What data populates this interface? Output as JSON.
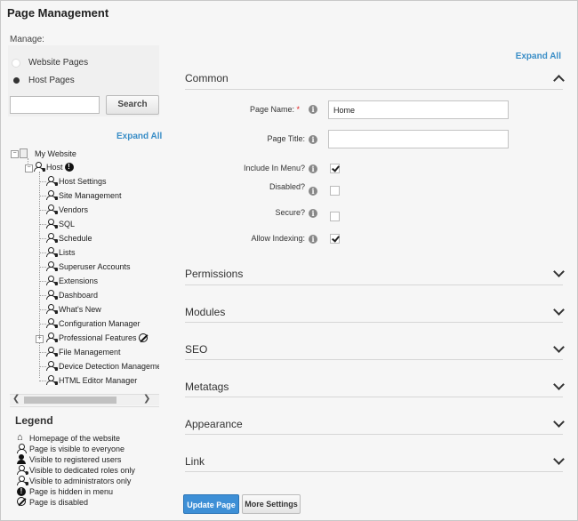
{
  "title": "Page Management",
  "manage_label": "Manage:",
  "page_type_options": [
    {
      "label": "Website Pages",
      "selected": false
    },
    {
      "label": "Host Pages",
      "selected": true
    }
  ],
  "search": {
    "value": "",
    "button_label": "Search"
  },
  "tree": {
    "expand_all": "Expand All",
    "root": "My Website",
    "host": "Host",
    "children": [
      "Host Settings",
      "Site Management",
      "Vendors",
      "SQL",
      "Schedule",
      "Lists",
      "Superuser Accounts",
      "Extensions",
      "Dashboard",
      "What's New",
      "Configuration Manager",
      "Professional Features",
      "File Management",
      "Device Detection Management",
      "HTML Editor Manager"
    ]
  },
  "legend": {
    "title": "Legend",
    "items": [
      {
        "icon": "home-icon",
        "label": "Homepage of the website"
      },
      {
        "icon": "user-outline-icon",
        "label": "Page is visible to everyone"
      },
      {
        "icon": "user-filled-icon",
        "label": "Visible to registered users"
      },
      {
        "icon": "user-roles-icon",
        "label": "Visible to dedicated roles only"
      },
      {
        "icon": "user-admin-icon",
        "label": "Visible to administrators only"
      },
      {
        "icon": "hidden-icon",
        "label": "Page is hidden in menu"
      },
      {
        "icon": "disabled-icon",
        "label": "Page is disabled"
      }
    ]
  },
  "right": {
    "expand_all": "Expand All",
    "common": {
      "title": "Common",
      "page_name_label": "Page Name:",
      "required_mark": "*",
      "page_name_value": "Home",
      "page_title_label": "Page Title:",
      "page_title_value": "",
      "include_in_menu_label": "Include In Menu?",
      "include_in_menu": true,
      "disabled_label": "Disabled?",
      "disabled": false,
      "secure_label": "Secure?",
      "secure": false,
      "allow_indexing_label": "Allow Indexing:",
      "allow_indexing": true
    },
    "sections": [
      "Permissions",
      "Modules",
      "SEO",
      "Metatags",
      "Appearance",
      "Link"
    ],
    "update_button": "Update Page",
    "more_button": "More Settings"
  }
}
